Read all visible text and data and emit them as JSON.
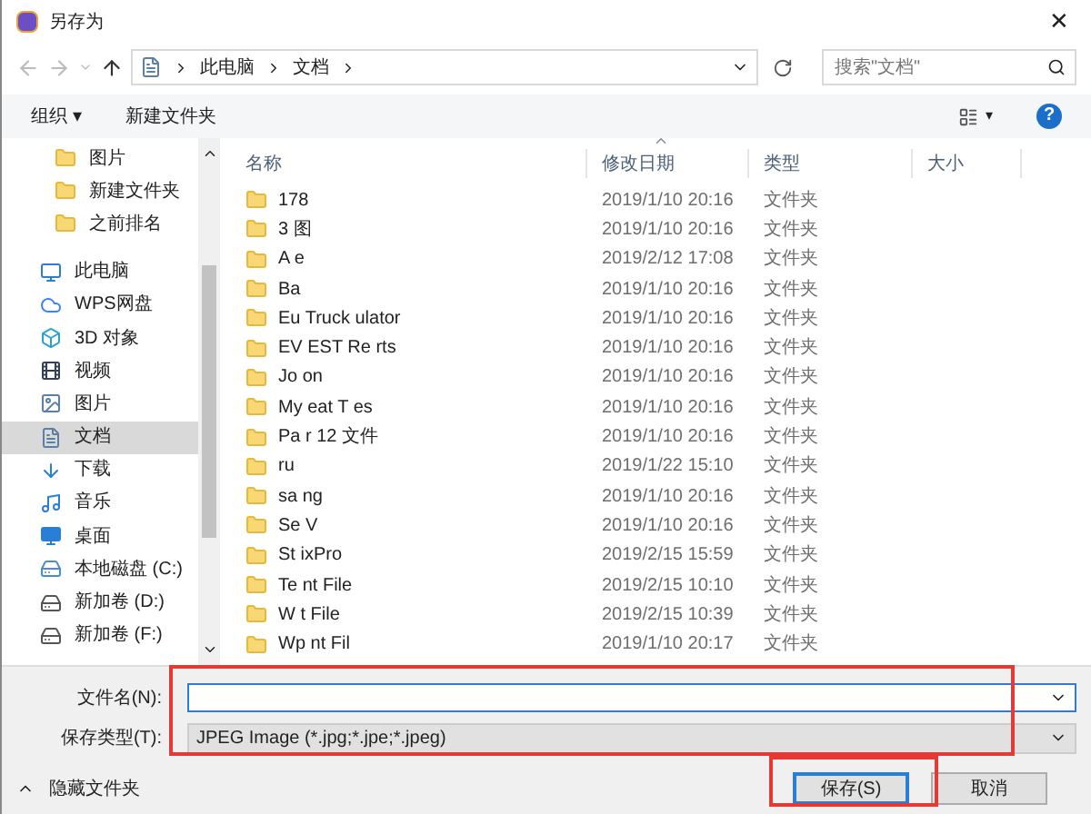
{
  "window": {
    "title": "另存为",
    "close": "✕"
  },
  "address": {
    "crumbs": [
      "此电脑",
      "文档"
    ],
    "search_placeholder": "搜索\"文档\""
  },
  "toolbar": {
    "organize": "组织 ▾",
    "new_folder": "新建文件夹",
    "view": "▾",
    "help": "?"
  },
  "sidebar": {
    "quick": [
      {
        "label": "图片",
        "kind": "folder",
        "selected": false
      },
      {
        "label": "新建文件夹",
        "kind": "folder",
        "selected": false
      },
      {
        "label": "之前排名",
        "kind": "folder",
        "selected": false
      }
    ],
    "pc": {
      "label": "此电脑",
      "kind": "pc",
      "selected": false,
      "children": [
        {
          "label": "WPS网盘",
          "kind": "cloud",
          "selected": false
        },
        {
          "label": "3D 对象",
          "kind": "cube",
          "selected": false
        },
        {
          "label": "视频",
          "kind": "video",
          "selected": false
        },
        {
          "label": "图片",
          "kind": "picture",
          "selected": false
        },
        {
          "label": "文档",
          "kind": "document",
          "selected": true
        },
        {
          "label": "下载",
          "kind": "download",
          "selected": false
        },
        {
          "label": "音乐",
          "kind": "music",
          "selected": false
        },
        {
          "label": "桌面",
          "kind": "desktop",
          "selected": false
        },
        {
          "label": "本地磁盘 (C:)",
          "kind": "system-drive",
          "selected": false
        },
        {
          "label": "新加卷 (D:)",
          "kind": "drive",
          "selected": false
        },
        {
          "label": "新加卷 (F:)",
          "kind": "drive",
          "selected": false
        }
      ]
    }
  },
  "table": {
    "columns": [
      "名称",
      "修改日期",
      "类型",
      "大小"
    ],
    "rows": [
      {
        "name": "178",
        "date": "2019/1/10 20:16",
        "type": "文件夹"
      },
      {
        "name": "3 图",
        "date": "2019/1/10 20:16",
        "type": "文件夹"
      },
      {
        "name": "A e",
        "date": "2019/2/12 17:08",
        "type": "文件夹"
      },
      {
        "name": "Ba",
        "date": "2019/1/10 20:16",
        "type": "文件夹"
      },
      {
        "name": "Eu Truck ulator",
        "date": "2019/1/10 20:16",
        "type": "文件夹"
      },
      {
        "name": "EV EST Re rts",
        "date": "2019/1/10 20:16",
        "type": "文件夹"
      },
      {
        "name": "Jo on",
        "date": "2019/1/10 20:16",
        "type": "文件夹"
      },
      {
        "name": "My eat T es",
        "date": "2019/1/10 20:16",
        "type": "文件夹"
      },
      {
        "name": "Pa r 12 文件",
        "date": "2019/1/10 20:16",
        "type": "文件夹"
      },
      {
        "name": "ru",
        "date": "2019/1/22 15:10",
        "type": "文件夹"
      },
      {
        "name": "sa ng",
        "date": "2019/1/10 20:16",
        "type": "文件夹"
      },
      {
        "name": "Se V",
        "date": "2019/1/10 20:16",
        "type": "文件夹"
      },
      {
        "name": "St ixPro",
        "date": "2019/2/15 15:59",
        "type": "文件夹"
      },
      {
        "name": "Te nt File",
        "date": "2019/2/15 10:10",
        "type": "文件夹"
      },
      {
        "name": "W t File",
        "date": "2019/2/15 10:39",
        "type": "文件夹"
      },
      {
        "name": "Wp nt Fil",
        "date": "2019/1/10 20:17",
        "type": "文件夹"
      }
    ]
  },
  "form": {
    "filename_label": "文件名(N):",
    "filetype_label": "保存类型(T):",
    "filetype_value": "JPEG Image (*.jpg;*.jpe;*.jpeg)"
  },
  "footer": {
    "hide_folders": "隐藏文件夹",
    "save": "保存(S)",
    "cancel": "取消"
  }
}
